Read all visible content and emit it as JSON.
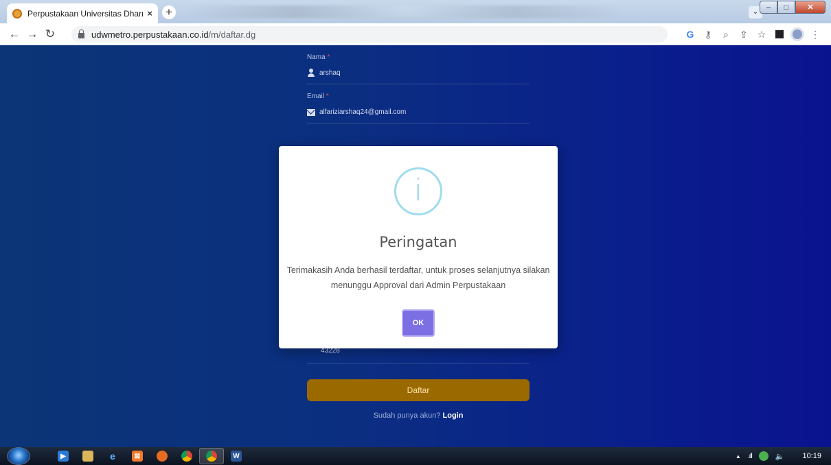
{
  "browser": {
    "tab_title": "Perpustakaan Universitas Dharma",
    "tab_close": "×",
    "new_tab": "+",
    "url_host": "udwmetro.perpustakaan.co.id",
    "url_path": "/m/daftar.dg"
  },
  "form": {
    "nama_label": "Nama",
    "nama_value": "arshaq",
    "email_label": "Email",
    "email_value": "alfariziarshaq24@gmail.com",
    "required_mark": "*",
    "zip_value": "43228",
    "submit_label": "Daftar",
    "login_prompt": "Sudah punya akun?",
    "login_link": "Login"
  },
  "modal": {
    "icon_glyph": "i",
    "title": "Peringatan",
    "message": "Terimakasih Anda berhasil terdaftar, untuk proses selanjutnya silakan menunggu Approval dari Admin Perpustakaan",
    "ok_label": "OK"
  },
  "taskbar": {
    "time": "10:19",
    "word_glyph": "W"
  },
  "colors": {
    "page_bg": "#0b2f80",
    "submit_bg": "#9a6a00",
    "ok_bg": "#7c6fe4",
    "info_icon": "#9fdcee"
  }
}
